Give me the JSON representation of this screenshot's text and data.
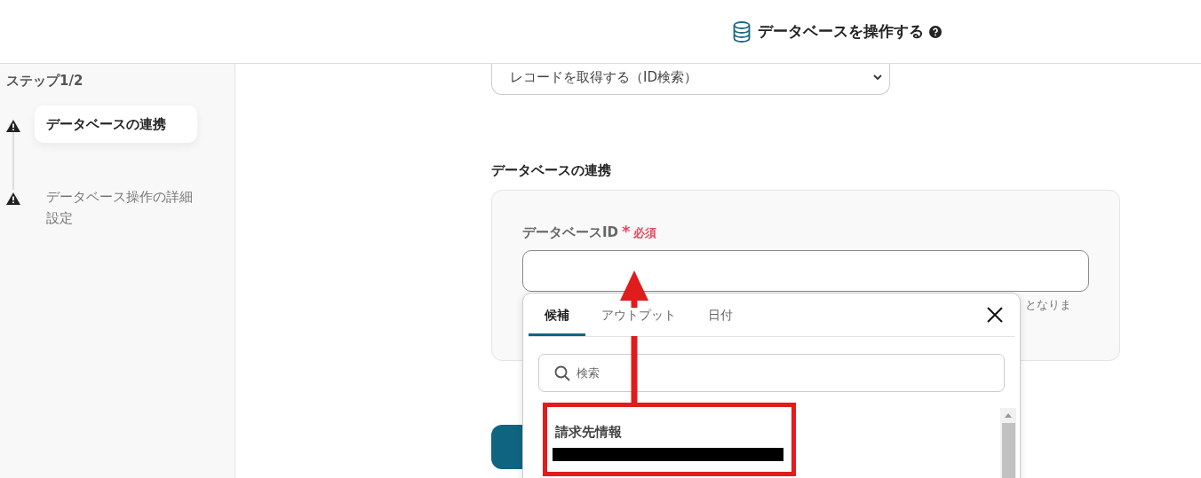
{
  "header": {
    "title": "データベースを操作する"
  },
  "sidebar": {
    "step_label": "ステップ1/2",
    "steps": [
      {
        "label": "データベースの連携",
        "selected": true
      },
      {
        "label": "データベース操作の詳細設定",
        "selected": false
      }
    ]
  },
  "action_select": {
    "value": "レコードを取得する（ID検索）"
  },
  "section": {
    "title": "データベースの連携",
    "field": {
      "label": "データベースID",
      "required_mark": "*",
      "required": "必須",
      "hint": "となりま"
    }
  },
  "popup": {
    "tabs": [
      {
        "label": "候補",
        "selected": true
      },
      {
        "label": "アウトプット",
        "selected": false
      },
      {
        "label": "日付",
        "selected": false
      }
    ],
    "search": {
      "placeholder": "検索"
    },
    "items": [
      {
        "title": "請求先情報"
      }
    ]
  }
}
